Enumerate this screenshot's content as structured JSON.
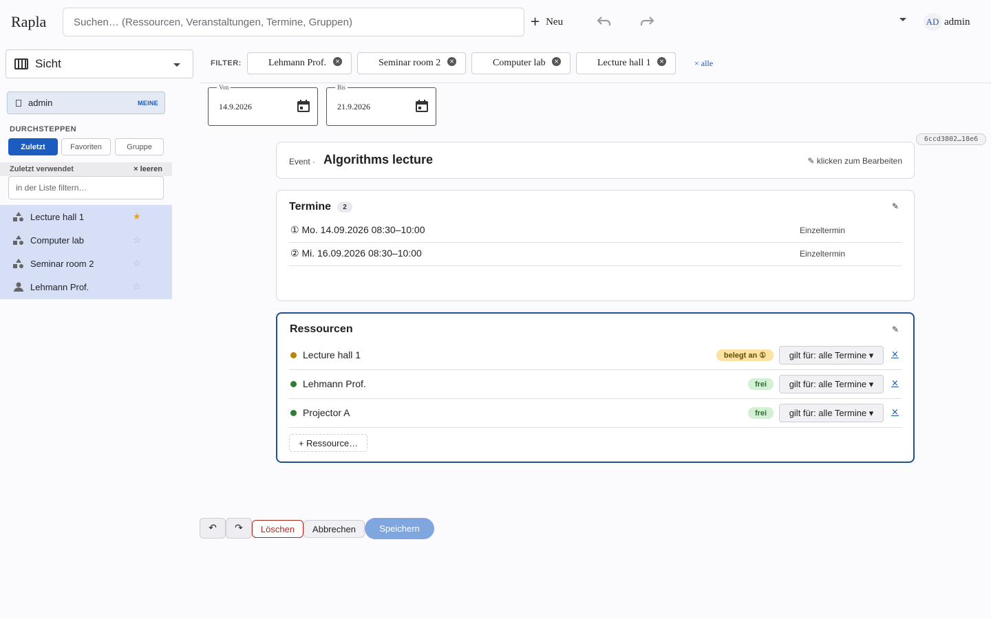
{
  "app": {
    "title": "Rapla"
  },
  "topbar": {
    "search_placeholder": "Suchen… (Ressourcen, Veranstaltungen, Termine, Gruppen)",
    "new_label": "Neu",
    "new_icon": "plus-icon",
    "undo_icon": "undo-icon",
    "redo_icon": "redo-icon",
    "user_initials": "AD",
    "user_name": "admin"
  },
  "sidebar": {
    "view_label": "Sicht",
    "me_name": "admin",
    "me_tag": "MEINE",
    "section_title": "DURCHSTEPPEN",
    "segments": [
      "Zuletzt",
      "Favoriten",
      "Gruppe"
    ],
    "active_segment": "Zuletzt",
    "recent_title": "Zuletzt verwendet",
    "recent_clear": "× leeren",
    "filter_placeholder": "in der Liste filtern…",
    "items": [
      {
        "label": "Lecture hall 1",
        "icon": "resource-icon",
        "favorite": true,
        "star": "★"
      },
      {
        "label": "Computer lab",
        "icon": "resource-icon",
        "favorite": false,
        "star": "☆"
      },
      {
        "label": "Seminar room 2",
        "icon": "resource-icon",
        "favorite": false,
        "star": "☆"
      },
      {
        "label": "Lehmann Prof.",
        "icon": "person-icon",
        "favorite": false,
        "star": "☆"
      }
    ]
  },
  "filter": {
    "label": "FILTER:",
    "chips": [
      "Lehmann Prof.",
      "Seminar room 2",
      "Computer lab",
      "Lecture hall 1"
    ],
    "remove_symbol": "×",
    "clear_all": "× alle"
  },
  "dates": {
    "from_label": "Von",
    "from_value": "14.9.2026",
    "to_label": "Bis",
    "to_value": "21.9.2026"
  },
  "id_badge": "6ccd3802…18e6",
  "event": {
    "type_label": "Event ·",
    "title": "Algorithms lecture",
    "edit_hint": "✎ klicken zum Bearbeiten"
  },
  "termine": {
    "title": "Termine",
    "count": "2",
    "edit_icon": "✎",
    "rows": [
      {
        "date": "① Mo. 14.09.2026 08:30–10:00",
        "kind": "Einzeltermin"
      },
      {
        "date": "② Mi. 16.09.2026 08:30–10:00",
        "kind": "Einzeltermin"
      }
    ]
  },
  "ressourcen": {
    "title": "Ressourcen",
    "edit_icon": "✎",
    "rows": [
      {
        "name": "Lecture hall 1",
        "status": "belegt an ①",
        "status_kind": "busy",
        "dot_color": "#b8860b",
        "scope": "gilt für: alle Termine ▾",
        "remove": "×"
      },
      {
        "name": "Lehmann Prof.",
        "status": "frei",
        "status_kind": "free",
        "dot_color": "#2e7d32",
        "scope": "gilt für: alle Termine ▾",
        "remove": "×"
      },
      {
        "name": "Projector A",
        "status": "frei",
        "status_kind": "free",
        "dot_color": "#2e7d32",
        "scope": "gilt für: alle Termine ▾",
        "remove": "×"
      }
    ],
    "add_label": "+ Ressource…"
  },
  "actions": {
    "undo_symbol": "↶",
    "redo_symbol": "↷",
    "delete": "Löschen",
    "cancel": "Abbrechen",
    "save": "Speichern"
  },
  "colors": {
    "accent": "#1a5cc0",
    "selection_bg": "#d6dff6",
    "danger": "#b3261e",
    "save_disabled": "#7fa6de",
    "resource_border": "#1d4f91"
  }
}
